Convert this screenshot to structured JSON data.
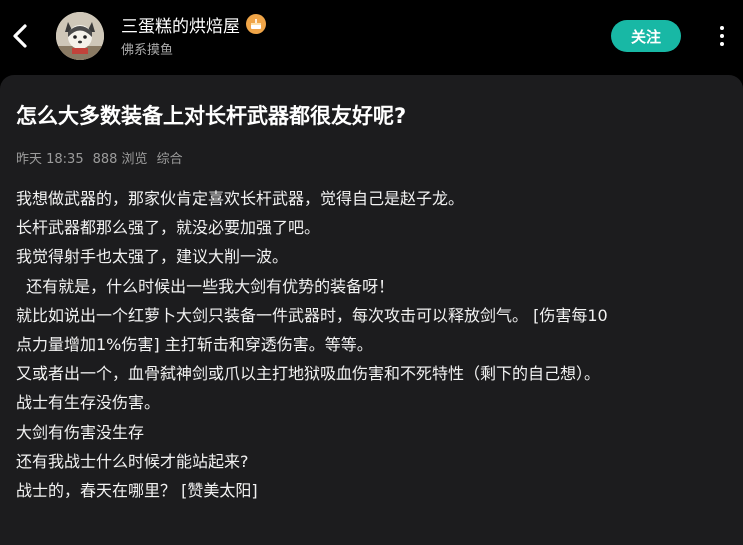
{
  "header": {
    "author_name": "三蛋糕的烘焙屋",
    "author_sub": "佛系摸鱼",
    "follow_label": "关注",
    "badge_icon": "cake-badge-icon"
  },
  "post": {
    "title": "怎么大多数装备上对长杆武器都很友好呢?",
    "meta": {
      "time": "昨天 18:35",
      "views": "888 浏览",
      "category": "综合"
    },
    "lines": [
      "我想做武器的，那家伙肯定喜欢长杆武器，觉得自己是赵子龙。",
      "长杆武器都那么强了，就没必要加强了吧。",
      "我觉得射手也太强了，建议大削一波。",
      "  还有就是，什么时候出一些我大剑有优势的装备呀！",
      "就比如说出一个红萝卜大剑只装备一件武器时，每次攻击可以释放剑气。 [伤害每10",
      "点力量增加1%伤害] 主打斩击和穿透伤害。等等。",
      "又或者出一个，血骨弑神剑或爪以主打地狱吸血伤害和不死特性（剩下的自己想）。",
      "战士有生存没伤害。",
      "大剑有伤害没生存",
      "还有我战士什么时候才能站起来?",
      "战士的，春天在哪里？ [赞美太阳]"
    ]
  },
  "colors": {
    "background": "#000000",
    "card": "#1c1c1e",
    "accent": "#18b8a5",
    "meta_text": "#9b9b9b"
  }
}
